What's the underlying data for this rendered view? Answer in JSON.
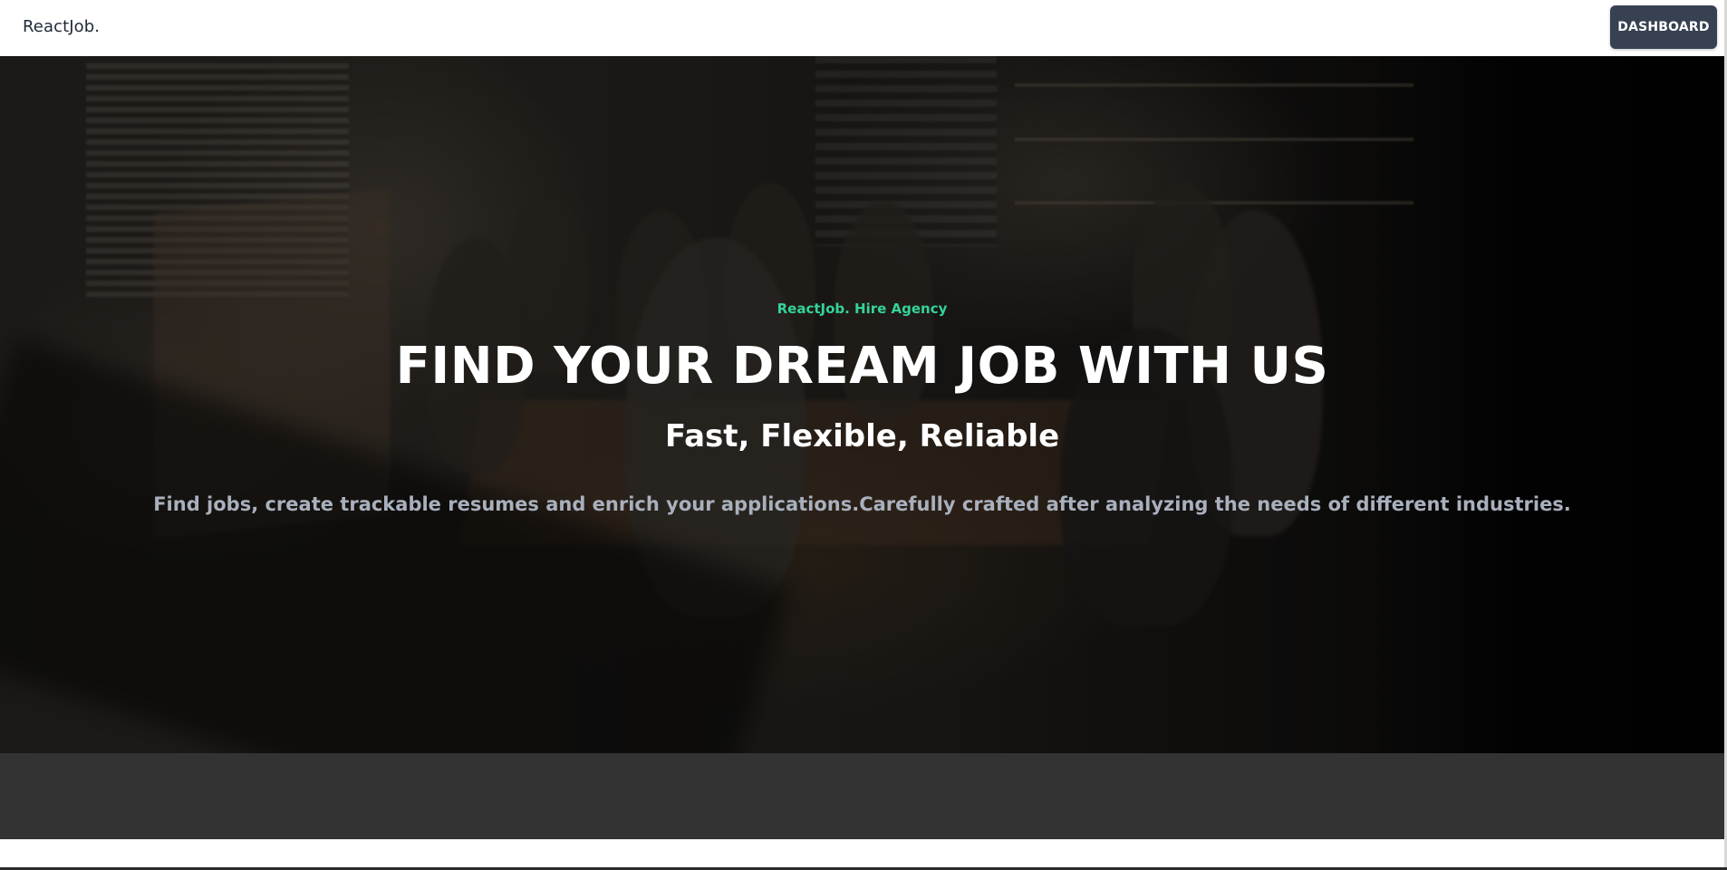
{
  "navbar": {
    "brand": "ReactJob.",
    "dashboard_label": "DASHBOARD"
  },
  "hero": {
    "tagline": "ReactJob. Hire Agency",
    "headline": "FIND YOUR DREAM JOB WITH US",
    "subheadline": "Fast, Flexible, Reliable",
    "description": "Find jobs, create trackable resumes and enrich your applications.Carefully crafted after analyzing the needs of different industries."
  },
  "colors": {
    "accent": "#34d399",
    "button_bg": "#374151",
    "band_bg": "#333333",
    "description_text": "#a9b0bd"
  }
}
